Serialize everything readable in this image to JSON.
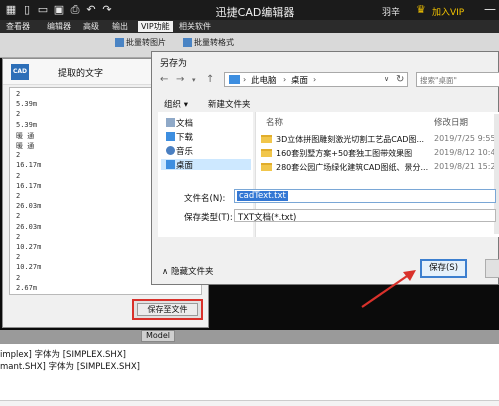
{
  "app": {
    "title": "迅捷CAD编辑器",
    "user": "羽辛",
    "vip": "加入VIP",
    "quick_icons": [
      "grid-icon",
      "new-file-icon",
      "open-folder-icon",
      "save-icon",
      "print-icon",
      "undo-icon",
      "redo-icon"
    ]
  },
  "menu": [
    "查看器",
    "编辑器",
    "高级",
    "输出",
    "VIP功能",
    "相关软件"
  ],
  "toolbar": [
    "批量转图片",
    "批量转格式"
  ],
  "extract_panel": {
    "title": "提取的文字",
    "logo": "CAD",
    "lines": [
      "2",
      "5.39m",
      "2",
      "5.39m",
      "暖 通",
      "暖 通",
      "2",
      "16.17m",
      "2",
      "16.17m",
      "2",
      "26.03m",
      "2",
      "26.03m",
      "2",
      "10.27m",
      "2",
      "10.27m",
      "2",
      "2.67m"
    ],
    "save_button": "保存至文件"
  },
  "save_dialog": {
    "title": "另存为",
    "address": {
      "part1": "此电脑",
      "part2": "桌面"
    },
    "search_placeholder": "搜索\"桌面\"",
    "organize": "组织 ▾",
    "new_folder": "新建文件夹",
    "nav_items": [
      "文档",
      "下载",
      "音乐",
      "桌面"
    ],
    "columns": {
      "name": "名称",
      "modified": "修改日期"
    },
    "files": [
      {
        "name": "3D立体拼图雕刻激光切割工艺品CAD图...",
        "date": "2019/7/25 9:55"
      },
      {
        "name": "160套别墅方案+50套独工图带效果图",
        "date": "2019/8/12 10:4"
      },
      {
        "name": "280套公园广场绿化建筑CAD图纸、景分...",
        "date": "2019/8/21 15:2"
      }
    ],
    "filename_label": "文件名(N):",
    "filename_value": "cadText.txt",
    "filetype_label": "保存类型(T):",
    "filetype_value": "TXT文档(*.txt)",
    "hide_folders": "隐藏文件夹",
    "save_button": "保存(S)"
  },
  "model_tab": "Model",
  "console": [
    "implex] 字体为 [SIMPLEX.SHX]",
    "mant.SHX] 字体为 [SIMPLEX.SHX]"
  ],
  "colors": {
    "highlight_red": "#d9312b",
    "accent_blue": "#3377d4",
    "vip_gold": "#f2c200"
  }
}
